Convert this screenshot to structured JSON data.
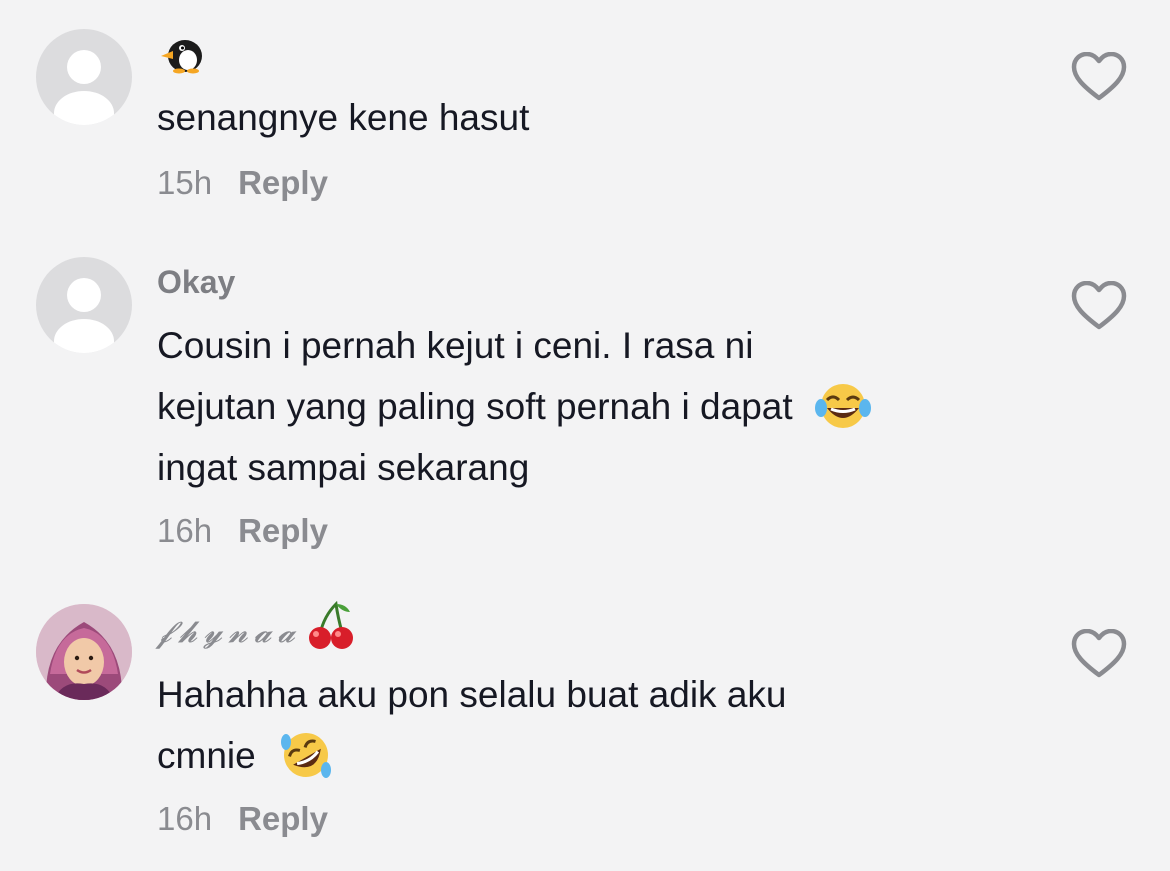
{
  "comments": [
    {
      "username": "",
      "text": "senangnye kene hasut",
      "time": "15h",
      "reply_label": "Reply"
    },
    {
      "username": "Okay",
      "text_lines": [
        "Cousin i pernah kejut i ceni. I rasa ni",
        "kejutan yang paling soft pernah i dapat",
        "ingat sampai sekarang"
      ],
      "time": "16h",
      "reply_label": "Reply"
    },
    {
      "username": "𝓯𝓱𝔂𝓷𝓪𝓪",
      "text_lines": [
        "Hahahha aku pon selalu buat adik aku",
        "cmnie"
      ],
      "time": "16h",
      "reply_label": "Reply"
    }
  ],
  "icons": {
    "penguin": "penguin-emoji",
    "laugh": "face-with-tears-of-joy-emoji",
    "rofl": "rolling-on-floor-laughing-emoji",
    "cherry": "cherries-emoji",
    "heart": "heart-outline-icon"
  },
  "colors": {
    "background": "#f3f3f4",
    "text": "#161823",
    "secondary": "#8a8b90"
  }
}
